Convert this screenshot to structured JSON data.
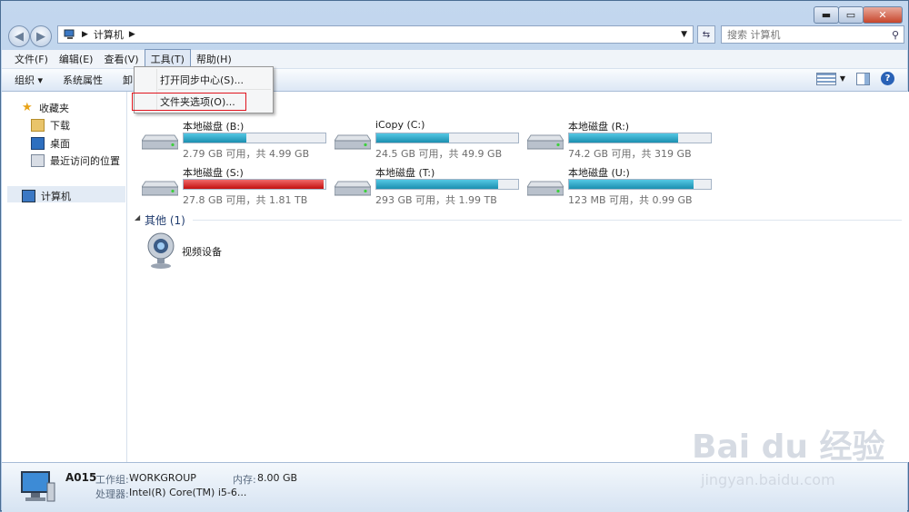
{
  "window": {
    "minimize": "▬",
    "maximize": "▭",
    "close": "✕"
  },
  "address": {
    "path": "计算机",
    "search_placeholder": "搜索 计算机"
  },
  "menubar": [
    "文件(F)",
    "编辑(E)",
    "查看(V)",
    "工具(T)",
    "帮助(H)"
  ],
  "toolbar": {
    "organize": "组织 ▾",
    "system_props": "系统属性",
    "hidden": "卸"
  },
  "tools_menu": [
    "打开同步中心(S)...",
    "文件夹选项(O)..."
  ],
  "sidebar": {
    "favorites": "收藏夹",
    "downloads": "下载",
    "desktop": "桌面",
    "recent": "最近访问的位置",
    "computer": "计算机"
  },
  "drives": [
    {
      "name": "本地磁盘 (B:)",
      "info": "2.79 GB 可用，共 4.99 GB",
      "used": 0.44
    },
    {
      "name": "iCopy (C:)",
      "info": "24.5 GB 可用，共 49.9 GB",
      "used": 0.51
    },
    {
      "name": "本地磁盘 (R:)",
      "info": "74.2 GB 可用，共 319 GB",
      "used": 0.77
    },
    {
      "name": "本地磁盘 (S:)",
      "info": "27.8 GB 可用，共 1.81 TB",
      "used": 0.99
    },
    {
      "name": "本地磁盘 (T:)",
      "info": "293 GB 可用，共 1.99 TB",
      "used": 0.86
    },
    {
      "name": "本地磁盘 (U:)",
      "info": "123 MB 可用，共 0.99 GB",
      "used": 0.88
    }
  ],
  "other_group": "其他 (1)",
  "video_device": "视频设备",
  "details": {
    "name": "A015",
    "workgroup_label": "工作组:",
    "workgroup": "WORKGROUP",
    "memory_label": "内存:",
    "memory": "8.00 GB",
    "cpu_label": "处理器:",
    "cpu": "Intel(R) Core(TM) i5-6..."
  },
  "watermark": {
    "logo": "Bai du 经验",
    "url": "jingyan.baidu.com"
  }
}
